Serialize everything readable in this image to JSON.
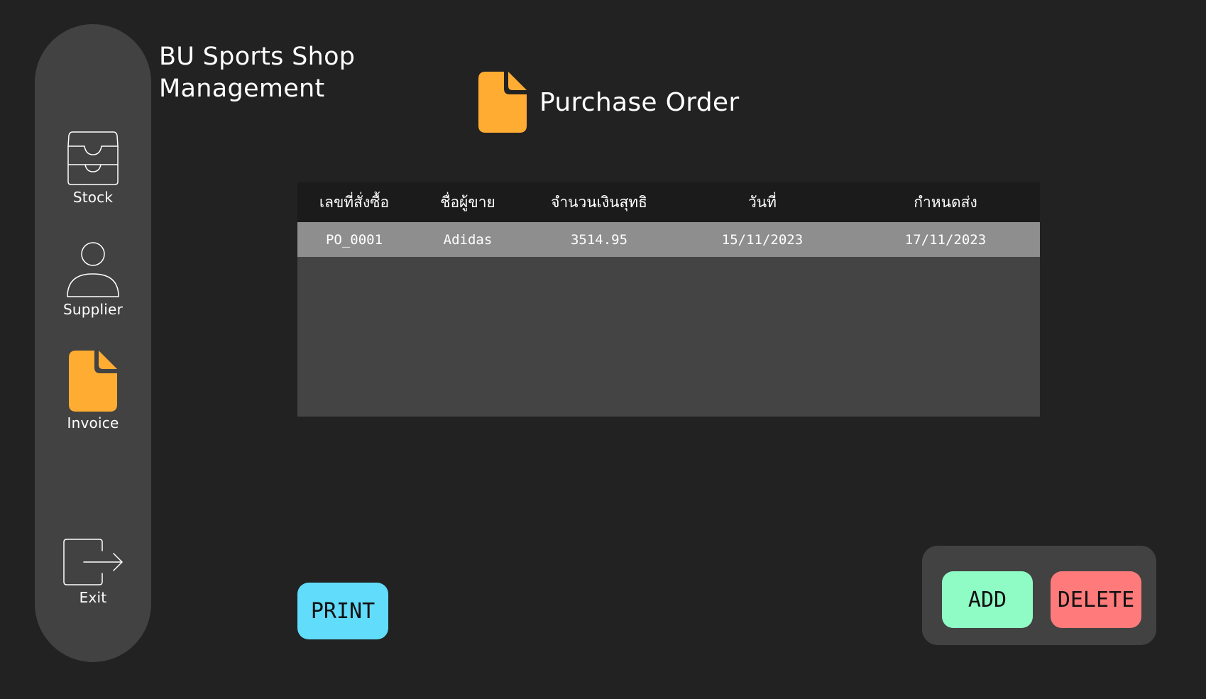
{
  "app": {
    "title_line1": "BU Sports Shop",
    "title_line2": "Management"
  },
  "sidebar": {
    "items": [
      {
        "label": "Stock",
        "icon": "inbox-tray-icon"
      },
      {
        "label": "Supplier",
        "icon": "user-icon"
      },
      {
        "label": "Invoice",
        "icon": "document-icon"
      },
      {
        "label": "Exit",
        "icon": "exit-icon"
      }
    ],
    "active": "Invoice"
  },
  "page": {
    "title": "Purchase Order",
    "icon": "document-icon"
  },
  "table": {
    "columns": [
      "เลขที่สั่งซื้อ",
      "ชื่อผู้ขาย",
      "จำนวนเงินสุทธิ",
      "วันที่",
      "กำหนดส่ง"
    ],
    "rows": [
      [
        "PO_0001",
        "Adidas",
        "3514.95",
        "15/11/2023",
        "17/11/2023"
      ]
    ]
  },
  "buttons": {
    "print": "PRINT",
    "add": "ADD",
    "delete": "DELETE"
  },
  "colors": {
    "background": "#222222",
    "sidebar": "#424242",
    "accent_orange": "#ffac33",
    "print": "#61dcfb",
    "add": "#8ffcc6",
    "delete": "#ff7b7b",
    "selected_row": "#8e8e8e",
    "table_header": "#1b1b1b"
  }
}
